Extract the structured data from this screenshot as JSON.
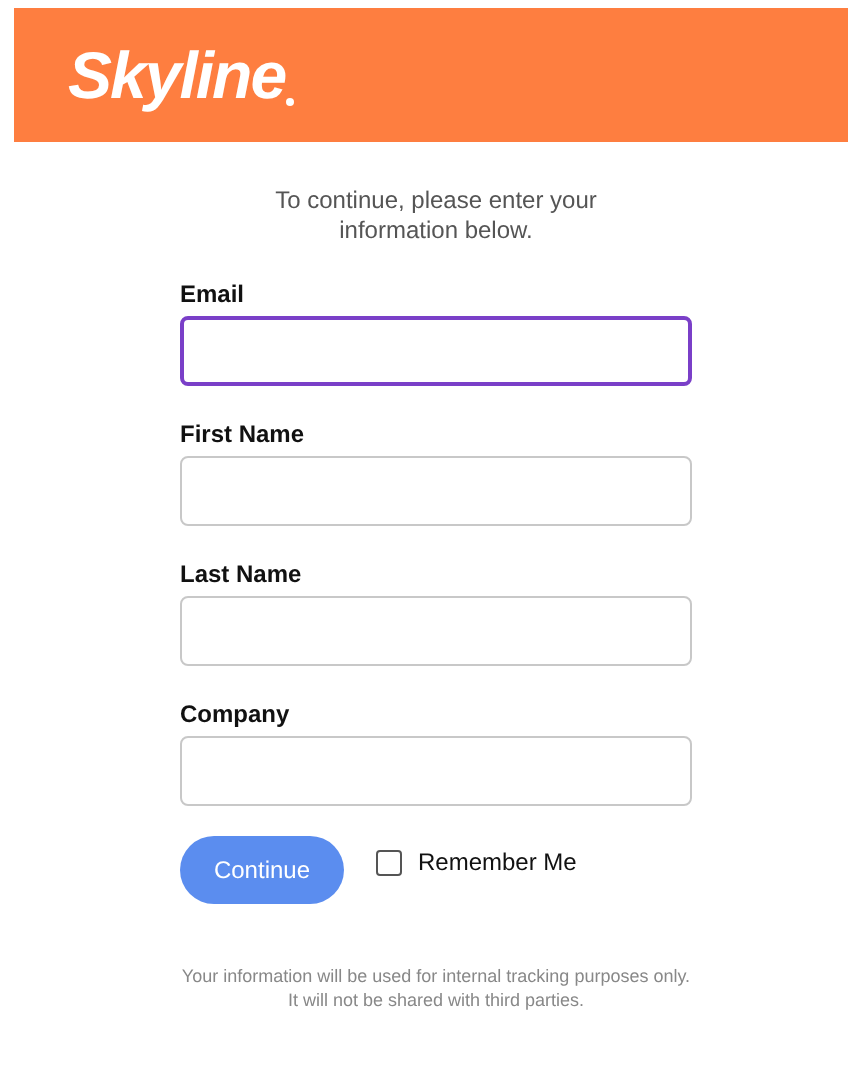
{
  "header": {
    "logo": "Skyline"
  },
  "intro": "To continue, please enter your information below.",
  "fields": [
    {
      "label": "Email",
      "focused": true
    },
    {
      "label": "First Name",
      "focused": false
    },
    {
      "label": "Last Name",
      "focused": false
    },
    {
      "label": "Company",
      "focused": false
    }
  ],
  "continue_button": "Continue",
  "remember_me": {
    "label": "Remember Me",
    "checked": false
  },
  "disclaimer": "Your information will be used for internal tracking purposes only. It will not be shared with third parties."
}
